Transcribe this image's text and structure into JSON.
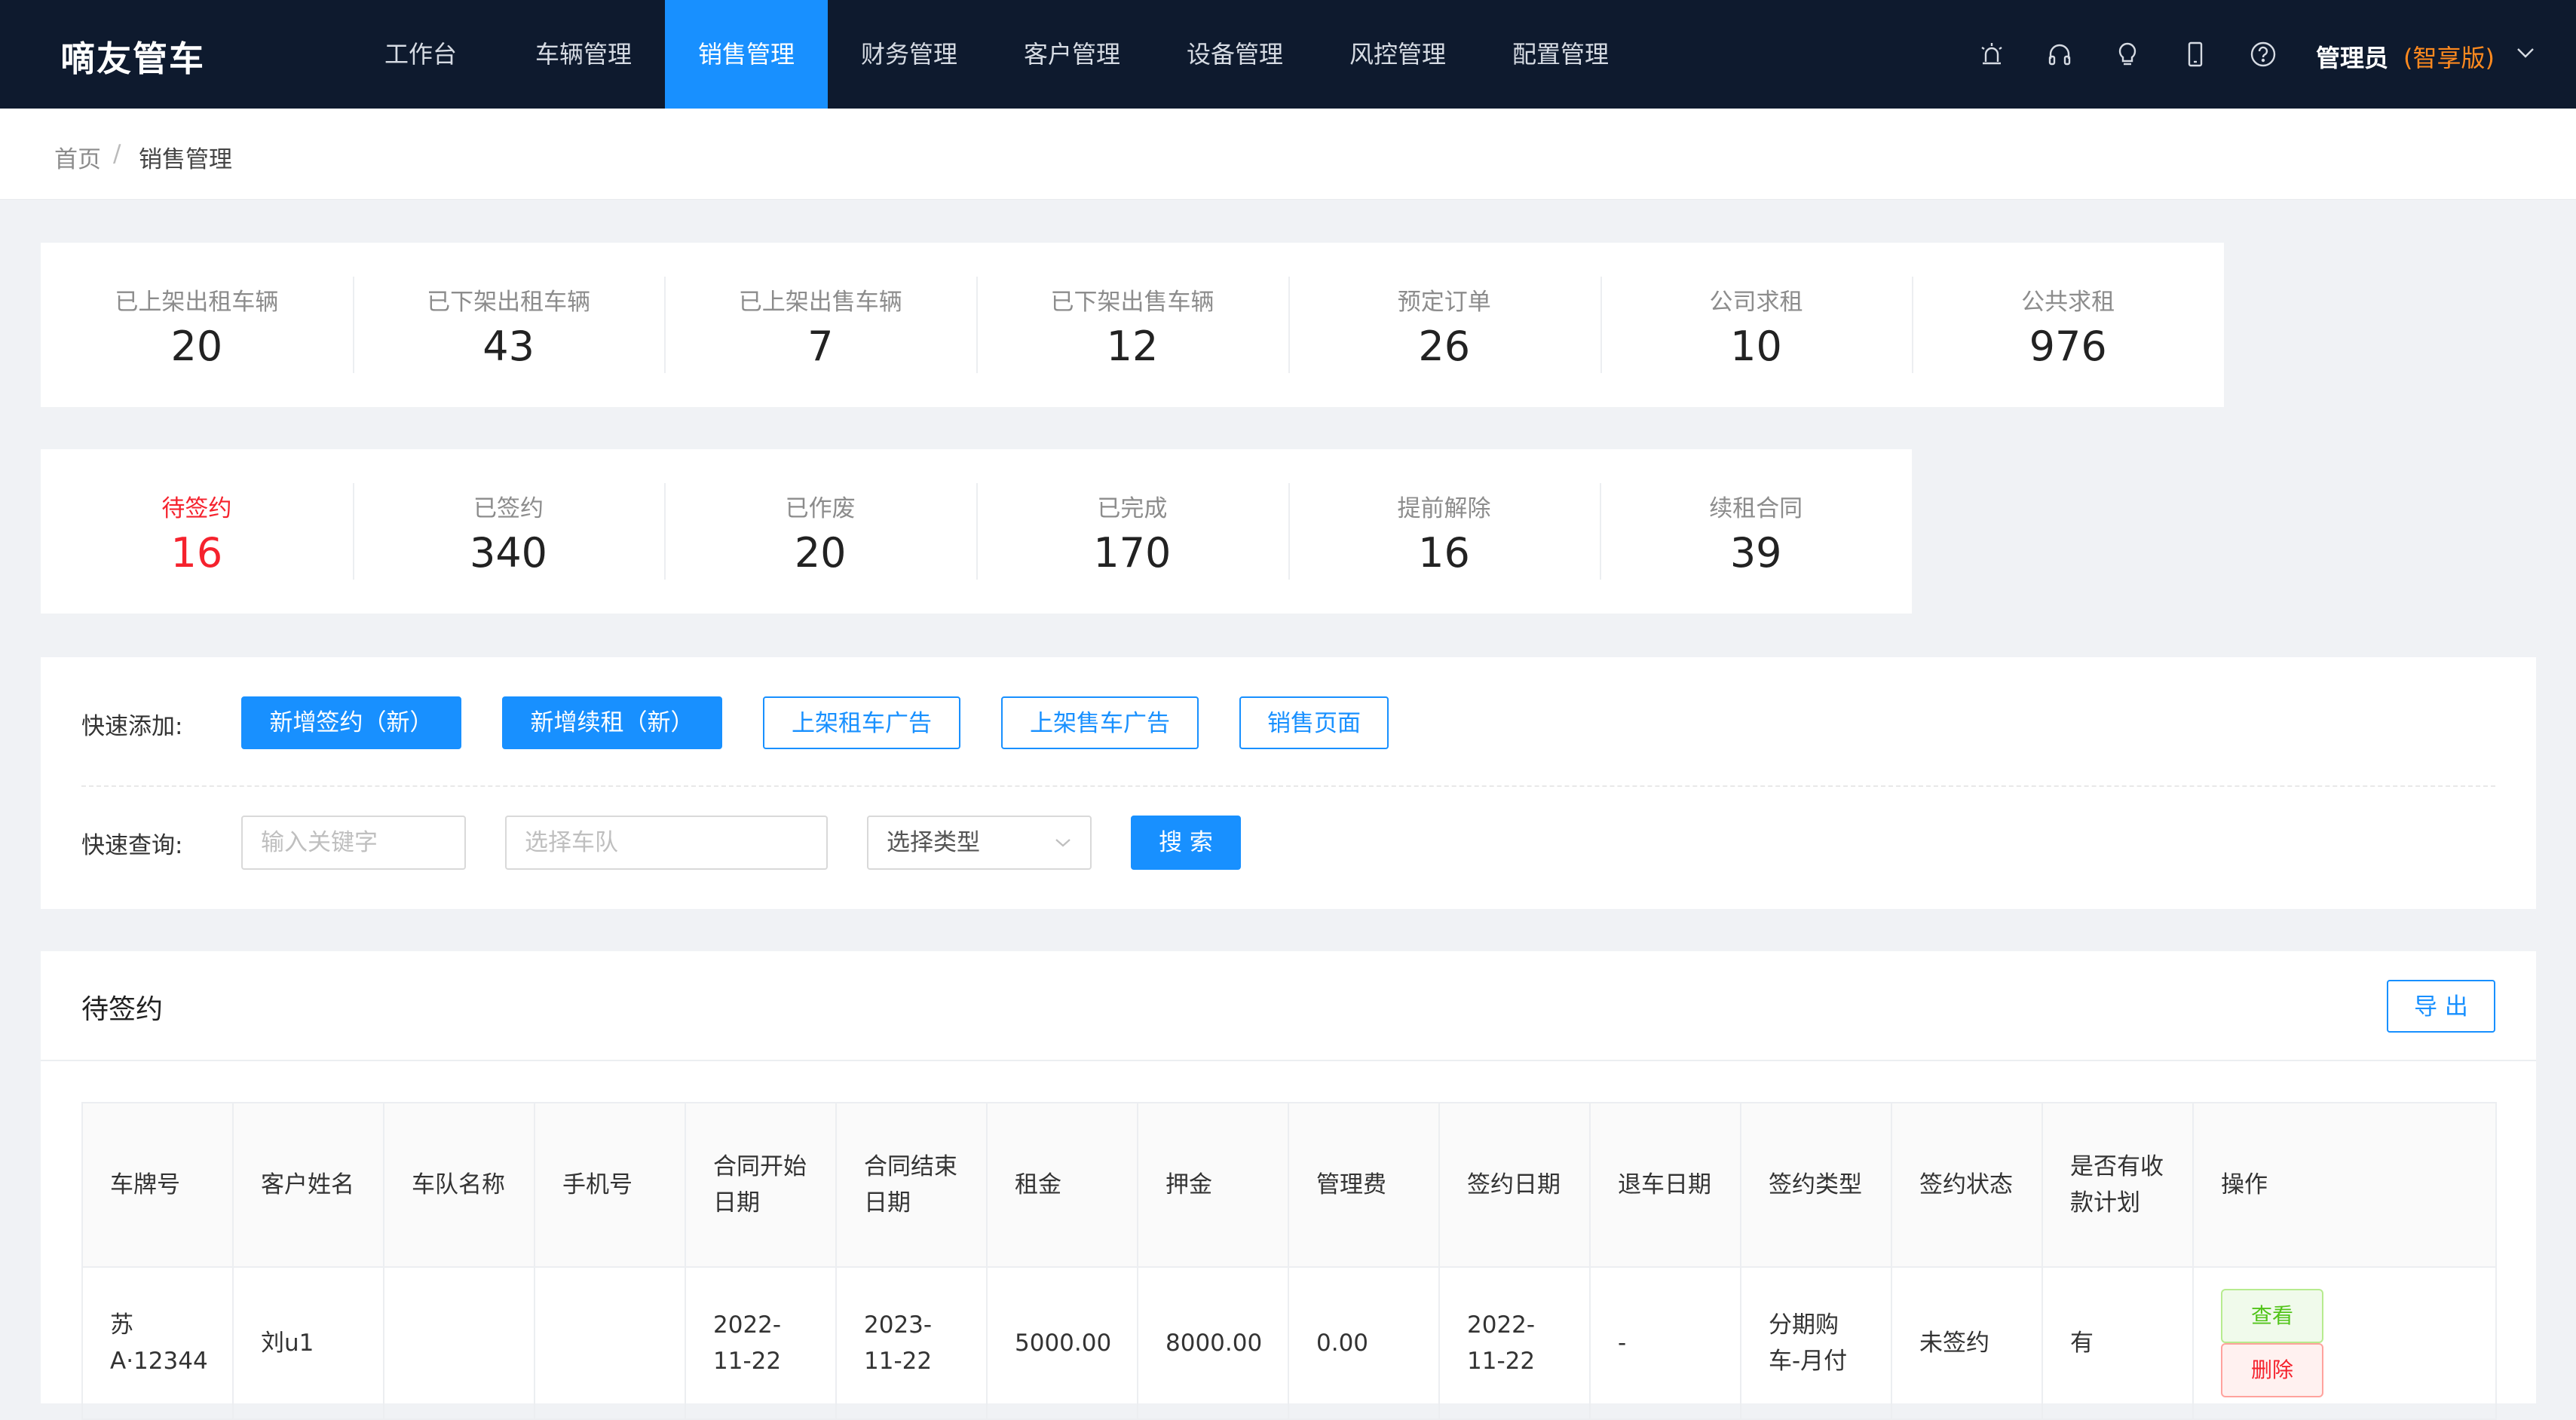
{
  "app": {
    "title": "嘀友管车"
  },
  "nav": [
    {
      "label": "工作台"
    },
    {
      "label": "车辆管理"
    },
    {
      "label": "销售管理"
    },
    {
      "label": "财务管理"
    },
    {
      "label": "客户管理"
    },
    {
      "label": "设备管理"
    },
    {
      "label": "风控管理"
    },
    {
      "label": "配置管理"
    }
  ],
  "nav_active": "销售管理",
  "user": {
    "name": "管理员",
    "edition": "(智享版)"
  },
  "breadcrumb": {
    "home": "首页",
    "separator": "/",
    "current": "销售管理"
  },
  "stats_row1": [
    {
      "label": "已上架出租车辆",
      "value": "20"
    },
    {
      "label": "已下架出租车辆",
      "value": "43"
    },
    {
      "label": "已上架出售车辆",
      "value": "7"
    },
    {
      "label": "已下架出售车辆",
      "value": "12"
    },
    {
      "label": "预定订单",
      "value": "26"
    },
    {
      "label": "公司求租",
      "value": "10"
    },
    {
      "label": "公共求租",
      "value": "976"
    }
  ],
  "stats_row2": [
    {
      "label": "待签约",
      "value": "16",
      "highlight": true
    },
    {
      "label": "已签约",
      "value": "340"
    },
    {
      "label": "已作废",
      "value": "20"
    },
    {
      "label": "已完成",
      "value": "170"
    },
    {
      "label": "提前解除",
      "value": "16"
    },
    {
      "label": "续租合同",
      "value": "39"
    }
  ],
  "quick_add": {
    "label": "快速添加:",
    "buttons": [
      "新增签约（新）",
      "新增续租（新）",
      "上架租车广告",
      "上架售车广告",
      "销售页面"
    ]
  },
  "quick_search": {
    "label": "快速查询:",
    "keyword_placeholder": "输入关键字",
    "fleet_placeholder": "选择车队",
    "type_select": "选择类型",
    "search_button": "搜 索"
  },
  "panel": {
    "title": "待签约",
    "export_button": "导 出",
    "columns": [
      "车牌号",
      "客户姓名",
      "车队名称",
      "手机号",
      "合同开始日期",
      "合同结束日期",
      "租金",
      "押金",
      "管理费",
      "签约日期",
      "退车日期",
      "签约类型",
      "签约状态",
      "是否有收款计划",
      "操作"
    ],
    "rows": [
      {
        "plate": "苏A·12344",
        "customer": "刘u1",
        "fleet": "",
        "phone": "",
        "start": "2022-11-22",
        "end": "2023-11-22",
        "rent": "5000.00",
        "deposit": "8000.00",
        "fee": "0.00",
        "sign_date": "2022-11-22",
        "return_date": "-",
        "sign_type": "分期购车-月付",
        "status": "未签约",
        "has_plan": "有",
        "view": "查看",
        "delete": "删除"
      }
    ]
  },
  "colors": {
    "nav_bg": "#0e1a2e",
    "accent": "#1890ff",
    "warn": "#f5222d",
    "edition": "#ff8a1f"
  }
}
